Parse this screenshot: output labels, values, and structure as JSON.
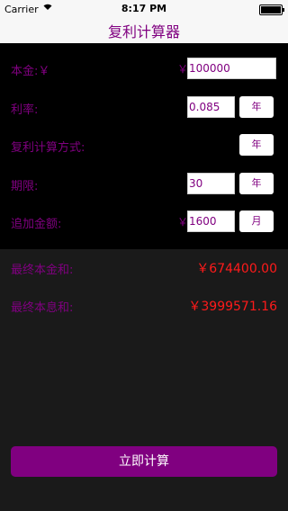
{
  "status": {
    "carrier": "Carrier",
    "wifi_icon": "wifi-icon",
    "time": "8:17 PM"
  },
  "nav": {
    "title": "复利计算器"
  },
  "form": {
    "principal": {
      "label": "本金:￥",
      "currency": "￥",
      "value": "100000"
    },
    "rate": {
      "label": "利率:",
      "value": "0.085",
      "unit": "年"
    },
    "compound": {
      "label": "复利计算方式:",
      "unit": "年"
    },
    "term": {
      "label": "期限:",
      "value": "30",
      "unit": "年"
    },
    "addition": {
      "label": "追加金额:",
      "currency": "￥",
      "value": "1600",
      "unit": "月"
    }
  },
  "results": {
    "final_principal": {
      "label": "最终本金和:",
      "value": "￥674400.00"
    },
    "final_total": {
      "label": "最终本息和:",
      "value": "￥3999571.16"
    }
  },
  "actions": {
    "calculate": "立即计算"
  },
  "colors": {
    "accent": "#800080",
    "result": "#ff1a1a",
    "form_bg": "#000000",
    "page_bg": "#1a1a1a"
  }
}
